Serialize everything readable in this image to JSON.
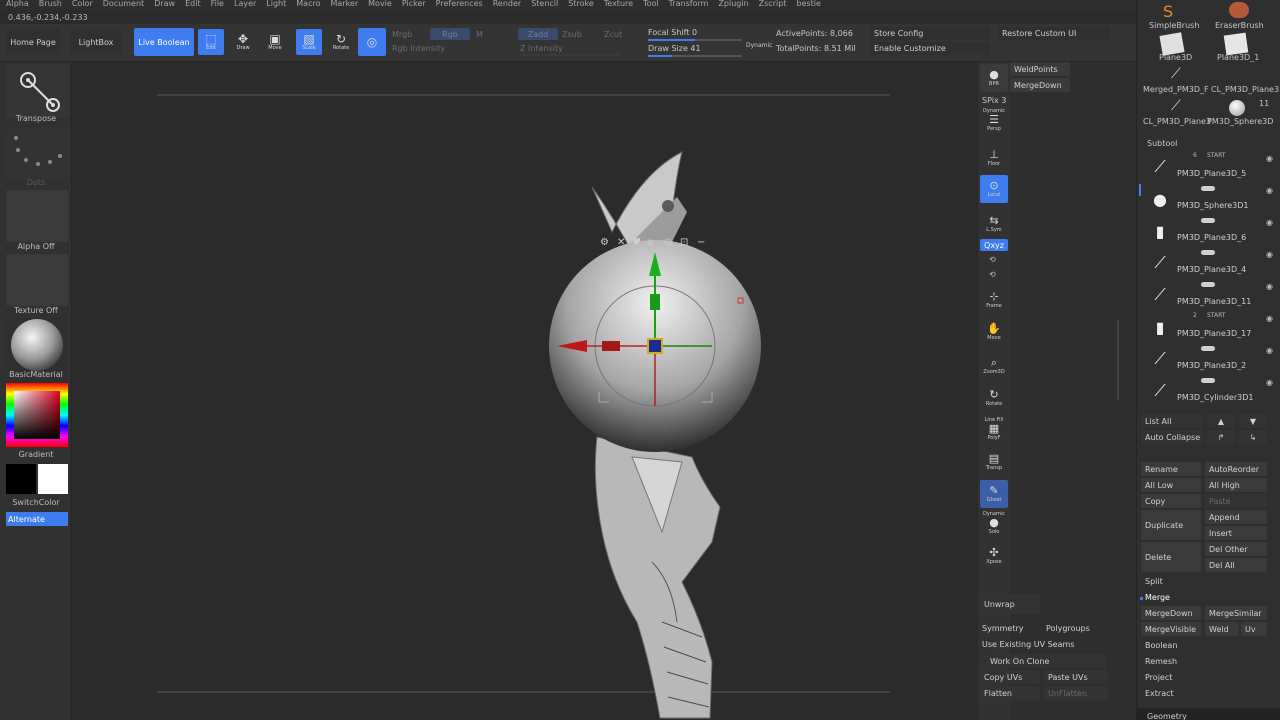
{
  "menu": [
    "Alpha",
    "Brush",
    "Color",
    "Document",
    "Draw",
    "Edit",
    "File",
    "Layer",
    "Light",
    "Macro",
    "Marker",
    "Movie",
    "Picker",
    "Preferences",
    "Render",
    "Stencil",
    "Stroke",
    "Texture",
    "Tool",
    "Transform",
    "Zplugin",
    "Zscript",
    "bestie"
  ],
  "coords": "0.436,-0.234,-0.233",
  "shelf": {
    "home_page": "Home Page",
    "lightbox": "LightBox",
    "live_boolean": "Live Boolean",
    "edit": "Edit",
    "draw": "Draw",
    "move": "Move",
    "scale": "Scale",
    "rotate": "Rotate",
    "mrgb": "Mrgb",
    "rgb": "Rgb",
    "m": "M",
    "rgb_intensity": "Rgb Intensity",
    "zadd": "Zadd",
    "zsub": "Zsub",
    "zcut": "Zcut",
    "z_intensity": "Z Intensity",
    "focal_shift": "Focal Shift 0",
    "draw_size": "Draw Size 41",
    "dynamic": "Dynamic",
    "active_points": "ActivePoints: 8,066",
    "total_points": "TotalPoints: 8.51 Mil",
    "store_config": "Store Config",
    "enable_customize": "Enable Customize",
    "restore_custom_ui": "Restore Custom UI",
    "focal_shift_fraction": 0.5,
    "draw_size_fraction": 0.25
  },
  "left": {
    "transpose": "Transpose",
    "dots": "Dots",
    "alpha_off": "Alpha Off",
    "texture_off": "Texture Off",
    "material": "BasicMaterial",
    "gradient": "Gradient",
    "switch_color": "SwitchColor",
    "alternate": "Alternate"
  },
  "rightshelf": {
    "bpr": "BPR",
    "spix": "SPix 3",
    "dynamic": "Dynamic",
    "persp": "Persp",
    "floor": "Floor",
    "local": "Local",
    "lsym": "L.Sym",
    "qxyz": "Qxyz",
    "frame": "Frame",
    "move": "Move",
    "zoom3d": "Zoom3D",
    "rotate": "Rotate",
    "line_fill": "Line Fill",
    "polyf": "PolyF",
    "transp": "Transp",
    "ghost": "Ghost",
    "dynamic2": "Dynamic",
    "solo": "Solo",
    "xpose": "Xpose"
  },
  "mid": {
    "weld_points": "WeldPoints",
    "merge_down": "MergeDown",
    "unwrap": "Unwrap",
    "symmetry": "Symmetry",
    "polygroups": "Polygroups",
    "use_existing_uv_seams": "Use Existing UV Seams",
    "work_on_clone": "Work On Clone",
    "copy_uvs": "Copy UVs",
    "paste_uvs": "Paste UVs",
    "flatten": "Flatten",
    "unflatten": "UnFlatten"
  },
  "tray": {
    "brushes": [
      "SimpleBrush",
      "EraserBrush",
      "Plane3D",
      "Plane3D_1",
      "Merged_PM3D_F",
      "CL_PM3D_Plane3",
      "CL_PM3D_Plane3",
      "PM3D_Sphere3D"
    ],
    "sphere_count": "11",
    "subtool_title": "Subtool",
    "start": "START",
    "start_num_1": "6",
    "start_num_2": "2",
    "subtools": [
      "PM3D_Plane3D_5",
      "PM3D_Sphere3D1",
      "PM3D_Plane3D_6",
      "PM3D_Plane3D_4",
      "PM3D_Plane3D_11",
      "PM3D_Plane3D_17",
      "PM3D_Plane3D_2",
      "PM3D_Cylinder3D1"
    ],
    "list_all": "List All",
    "auto_collapse": "Auto Collapse",
    "rename": "Rename",
    "auto_reorder": "AutoReorder",
    "all_low": "All Low",
    "all_high": "All High",
    "copy": "Copy",
    "paste": "Paste",
    "duplicate": "Duplicate",
    "append": "Append",
    "insert": "Insert",
    "delete": "Delete",
    "del_other": "Del Other",
    "del_all": "Del All",
    "split": "Split",
    "merge": "Merge",
    "merge_down": "MergeDown",
    "merge_similar": "MergeSimilar",
    "merge_visible": "MergeVisible",
    "weld": "Weld",
    "uv": "Uv",
    "boolean": "Boolean",
    "remesh": "Remesh",
    "project": "Project",
    "extract": "Extract",
    "geometry": "Geometry"
  },
  "colors": {
    "accent": "#3f7cf0",
    "background": "#2b2b2b",
    "panel": "#313131"
  }
}
